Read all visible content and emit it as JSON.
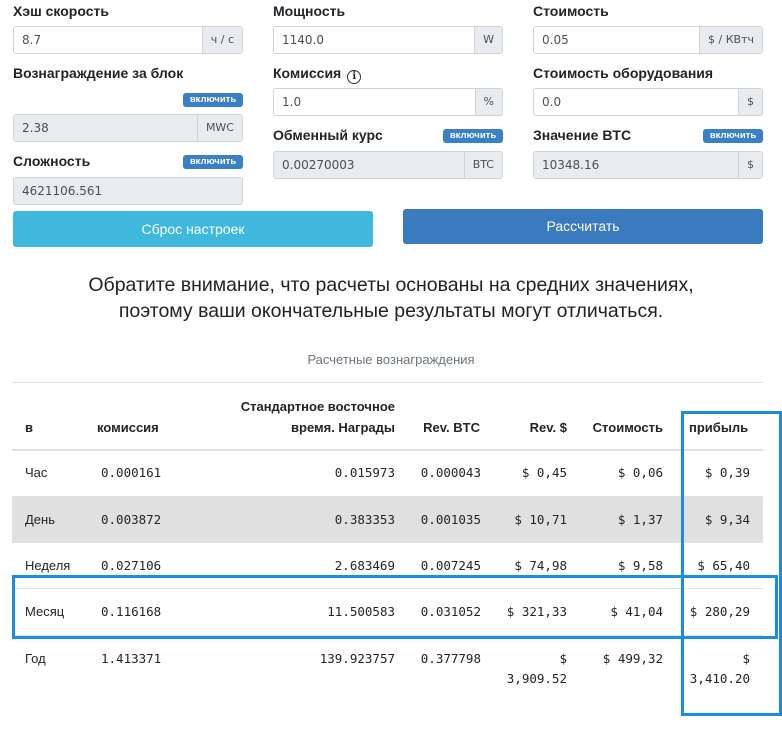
{
  "form": {
    "hashrate": {
      "label": "Хэш скорость",
      "value": "8.7",
      "unit": "ч / с"
    },
    "power": {
      "label": "Мощность",
      "value": "1140.0",
      "unit": "W"
    },
    "cost": {
      "label": "Стоимость",
      "value": "0.05",
      "unit": "$ / КВтч"
    },
    "block_reward": {
      "label": "Вознаграждение за блок",
      "toggle": "включить",
      "value": "2.38",
      "unit": "MWC"
    },
    "fee": {
      "label": "Комиссия",
      "value": "1.0",
      "unit": "%"
    },
    "hardware_cost": {
      "label": "Стоимость оборудования",
      "value": "0.0",
      "unit": "$"
    },
    "difficulty": {
      "label": "Сложность",
      "toggle": "включить",
      "value": "4621106.561"
    },
    "exchange_rate": {
      "label": "Обменный курс",
      "toggle": "включить",
      "value": "0.00270003",
      "unit": "BTC"
    },
    "btc_value": {
      "label": "Значение BTC",
      "toggle": "включить",
      "value": "10348.16",
      "unit": "$"
    }
  },
  "buttons": {
    "reset": "Сброс настроек",
    "calculate": "Рассчитать"
  },
  "notice": {
    "line1": "Обратите внимание, что расчеты основаны на средних значениях,",
    "line2": "поэтому ваши окончательные результаты могут отличаться."
  },
  "table": {
    "caption": "Расчетные вознаграждения",
    "headers": {
      "period": "в",
      "fee": "комиссия",
      "reward_line1": "Стандартное восточное",
      "reward_line2": "время. Награды",
      "rev_btc": "Rev. BTC",
      "rev_usd": "Rev. $",
      "cost": "Стоимость",
      "profit": "прибыль"
    },
    "rows": [
      {
        "period": "Час",
        "fee": "0.000161",
        "reward": "0.015973",
        "rev_btc": "0.000043",
        "rev_usd": "$ 0,45",
        "cost": "$ 0,06",
        "profit": "$ 0,39"
      },
      {
        "period": "День",
        "fee": "0.003872",
        "reward": "0.383353",
        "rev_btc": "0.001035",
        "rev_usd": "$ 10,71",
        "cost": "$ 1,37",
        "profit": "$ 9,34"
      },
      {
        "period": "Неделя",
        "fee": "0.027106",
        "reward": "2.683469",
        "rev_btc": "0.007245",
        "rev_usd": "$ 74,98",
        "cost": "$ 9,58",
        "profit": "$ 65,40"
      },
      {
        "period": "Месяц",
        "fee": "0.116168",
        "reward": "11.500583",
        "rev_btc": "0.031052",
        "rev_usd": "$ 321,33",
        "cost": "$ 41,04",
        "profit": "$ 280,29"
      },
      {
        "period": "Год",
        "fee": "1.413371",
        "reward": "139.923757",
        "rev_btc": "0.377798",
        "rev_usd_line1": "$",
        "rev_usd_line2": "3,909.52",
        "cost": "$ 499,32",
        "profit_line1": "$",
        "profit_line2": "3,410.20"
      }
    ]
  },
  "colors": {
    "reset_button": "#3fb8dc",
    "calculate_button": "#3a7abf",
    "badge": "#3a80c6",
    "highlight": "#1a8de0",
    "striped_row": "#e0e0e0"
  }
}
